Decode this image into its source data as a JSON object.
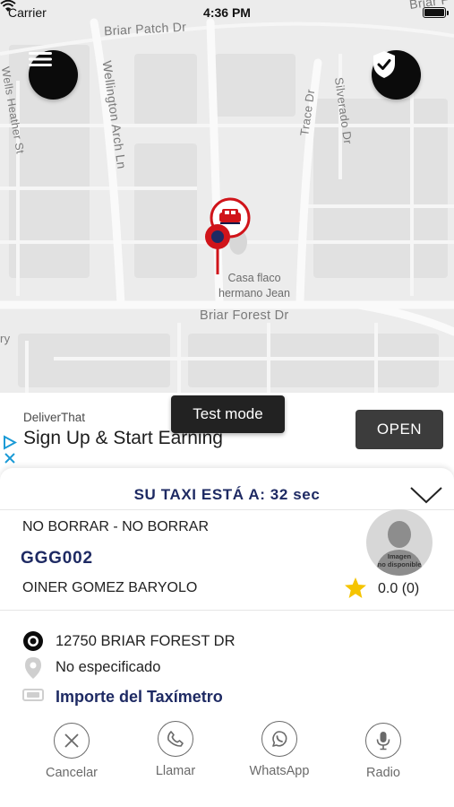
{
  "status_bar": {
    "carrier": "Carrier",
    "time": "4:36 PM"
  },
  "map": {
    "streets": {
      "briar_patch": "Briar Patch Dr",
      "briar_top": "Briar F",
      "wellington": "Wellington Arch Ln",
      "wells_heather": "Wells Heather St",
      "trace": "Trace Dr",
      "silverado": "Silverado Dr",
      "briar_forest": "Briar Forest Dr",
      "ry": "ry"
    },
    "place_label": "Casa flaco hermano Jean"
  },
  "ad": {
    "brand": "DeliverThat",
    "headline": "Sign Up & Start Earning",
    "cta": "OPEN",
    "test_mode": "Test mode"
  },
  "trip": {
    "eta_text": "SU TAXI ESTÁ A: 32 sec",
    "vehicle_description": "NO BORRAR - NO BORRAR",
    "plate": "GGG002",
    "driver_name": "OINER GOMEZ BARYOLO",
    "avatar_placeholder_line1": "Imagen",
    "avatar_placeholder_line2": "no disponible",
    "rating": "0.0 (0)",
    "pickup_address": "12750 BRIAR FOREST DR",
    "destination": "No especificado",
    "fare_label": "Importe del Taxímetro"
  },
  "actions": [
    {
      "label": "Cancelar",
      "icon": "close-icon"
    },
    {
      "label": "Llamar",
      "icon": "phone-icon"
    },
    {
      "label": "WhatsApp",
      "icon": "whatsapp-icon"
    },
    {
      "label": "Radio",
      "icon": "microphone-icon"
    }
  ],
  "colors": {
    "accent_navy": "#1e2a63",
    "marker_red": "#d0141a",
    "star_yellow": "#f5c400",
    "map_background": "#ececec"
  }
}
